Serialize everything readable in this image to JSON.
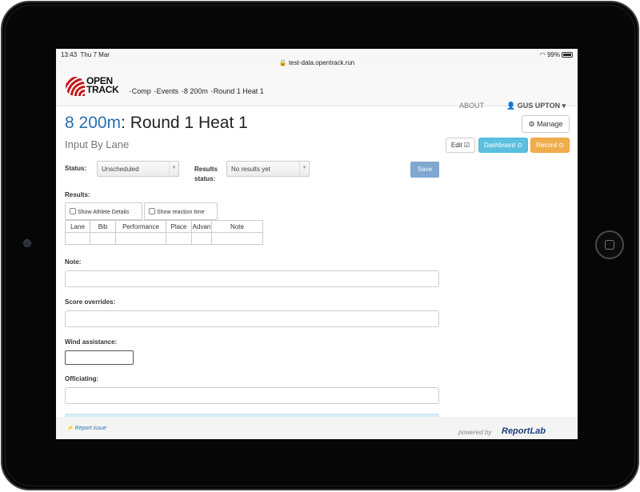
{
  "status_bar": {
    "time": "13:43",
    "date": "Thu 7 Mar",
    "url": "test-data.opentrack.run",
    "battery": "99%"
  },
  "logo": {
    "line1": "OPEN",
    "line2": "TRACK"
  },
  "breadcrumbs": [
    "Comp",
    "Events",
    "8 200m",
    "Round 1 Heat 1"
  ],
  "nav": {
    "about": "ABOUT",
    "user": "GUS UPTON"
  },
  "page": {
    "event": "8 200m",
    "title_rest": ": Round 1 Heat 1",
    "subtitle": "Input By Lane"
  },
  "buttons": {
    "manage": "Manage",
    "edit": "Edit",
    "dashboard": "Dashboard",
    "record": "Record",
    "save": "Save"
  },
  "form": {
    "status_label": "Status:",
    "status_value": "Unscheduled",
    "results_status_label1": "Results",
    "results_status_label2": "status:",
    "results_status_value": "No results yet",
    "results_label": "Results:",
    "show_athlete_details": "Show Athlete Details",
    "show_reaction_time": "Show reaction time",
    "columns": [
      "Lane",
      "Bib",
      "Performance",
      "Place",
      "Advan",
      "Note"
    ],
    "note_label": "Note:",
    "score_overrides_label": "Score overrides:",
    "wind_label": "Wind assistance:",
    "officiating_label": "Officiating:"
  },
  "footer": {
    "report": "Report issue",
    "powered": "powered by",
    "brand": "ReportLab"
  },
  "colors": {
    "accent_blue": "#2a6fb0",
    "brand_red": "#c61a1a",
    "info": "#5bc0de",
    "warning": "#f0ad4e"
  }
}
